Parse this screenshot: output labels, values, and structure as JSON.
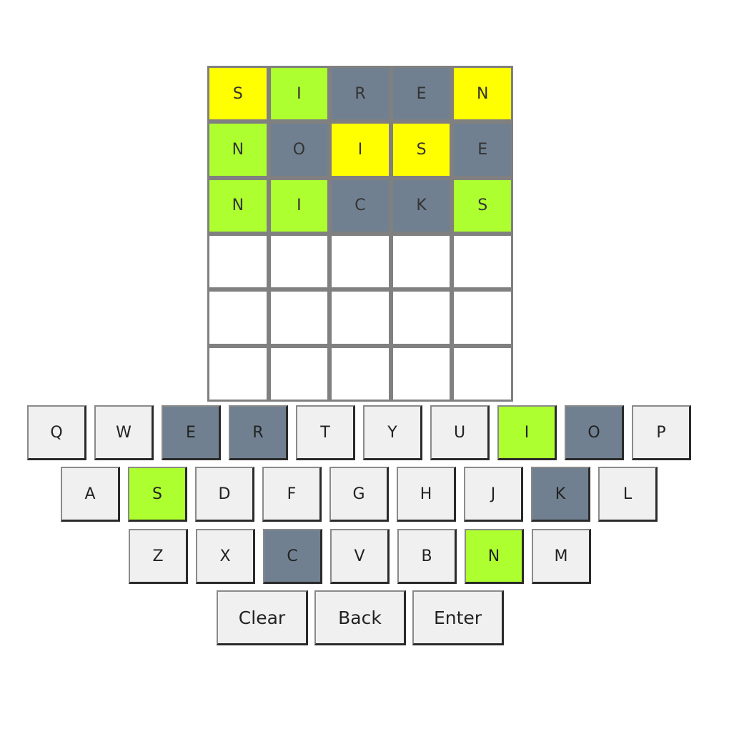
{
  "board": {
    "rows": [
      [
        {
          "letter": "S",
          "state": "present"
        },
        {
          "letter": "I",
          "state": "correct"
        },
        {
          "letter": "R",
          "state": "absent"
        },
        {
          "letter": "E",
          "state": "absent"
        },
        {
          "letter": "N",
          "state": "present"
        }
      ],
      [
        {
          "letter": "N",
          "state": "correct"
        },
        {
          "letter": "O",
          "state": "absent"
        },
        {
          "letter": "I",
          "state": "present"
        },
        {
          "letter": "S",
          "state": "present"
        },
        {
          "letter": "E",
          "state": "absent"
        }
      ],
      [
        {
          "letter": "N",
          "state": "correct"
        },
        {
          "letter": "I",
          "state": "correct"
        },
        {
          "letter": "C",
          "state": "absent"
        },
        {
          "letter": "K",
          "state": "absent"
        },
        {
          "letter": "S",
          "state": "correct"
        }
      ],
      [
        {
          "letter": "",
          "state": "empty"
        },
        {
          "letter": "",
          "state": "empty"
        },
        {
          "letter": "",
          "state": "empty"
        },
        {
          "letter": "",
          "state": "empty"
        },
        {
          "letter": "",
          "state": "empty"
        }
      ],
      [
        {
          "letter": "",
          "state": "empty"
        },
        {
          "letter": "",
          "state": "empty"
        },
        {
          "letter": "",
          "state": "empty"
        },
        {
          "letter": "",
          "state": "empty"
        },
        {
          "letter": "",
          "state": "empty"
        }
      ],
      [
        {
          "letter": "",
          "state": "empty"
        },
        {
          "letter": "",
          "state": "empty"
        },
        {
          "letter": "",
          "state": "empty"
        },
        {
          "letter": "",
          "state": "empty"
        },
        {
          "letter": "",
          "state": "empty"
        }
      ]
    ]
  },
  "keyboard": {
    "rows": [
      [
        {
          "key": "Q",
          "state": "unused"
        },
        {
          "key": "W",
          "state": "unused"
        },
        {
          "key": "E",
          "state": "absent"
        },
        {
          "key": "R",
          "state": "absent"
        },
        {
          "key": "T",
          "state": "unused"
        },
        {
          "key": "Y",
          "state": "unused"
        },
        {
          "key": "U",
          "state": "unused"
        },
        {
          "key": "I",
          "state": "correct"
        },
        {
          "key": "O",
          "state": "absent"
        },
        {
          "key": "P",
          "state": "unused"
        }
      ],
      [
        {
          "key": "A",
          "state": "unused"
        },
        {
          "key": "S",
          "state": "correct"
        },
        {
          "key": "D",
          "state": "unused"
        },
        {
          "key": "F",
          "state": "unused"
        },
        {
          "key": "G",
          "state": "unused"
        },
        {
          "key": "H",
          "state": "unused"
        },
        {
          "key": "J",
          "state": "unused"
        },
        {
          "key": "K",
          "state": "absent"
        },
        {
          "key": "L",
          "state": "unused"
        }
      ],
      [
        {
          "key": "Z",
          "state": "unused"
        },
        {
          "key": "X",
          "state": "unused"
        },
        {
          "key": "C",
          "state": "absent"
        },
        {
          "key": "V",
          "state": "unused"
        },
        {
          "key": "B",
          "state": "unused"
        },
        {
          "key": "N",
          "state": "correct"
        },
        {
          "key": "M",
          "state": "unused"
        }
      ]
    ],
    "actions": {
      "clear_label": "Clear",
      "back_label": "Back",
      "enter_label": "Enter"
    }
  },
  "colors": {
    "present": "#ffff00",
    "correct": "#adff2f",
    "absent": "#708090",
    "key_default": "#f0f0f0",
    "board_border": "#808080"
  }
}
